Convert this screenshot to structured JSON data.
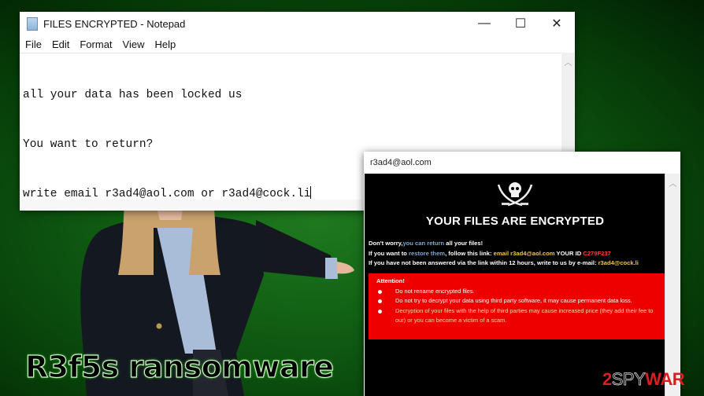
{
  "notepad": {
    "title": "FILES ENCRYPTED - Notepad",
    "controls": {
      "minimize": "—",
      "maximize": "☐",
      "close": "✕"
    },
    "menu": [
      "File",
      "Edit",
      "Format",
      "View",
      "Help"
    ],
    "lines": [
      "all your data has been locked us",
      "You want to return?",
      "write email r3ad4@aol.com or r3ad4@cock.li"
    ]
  },
  "ransom_window": {
    "title": "r3ad4@aol.com",
    "heading": "YOUR FILES ARE ENCRYPTED",
    "line1": {
      "a": "Don't worry,",
      "b": "you can return",
      "c": " all your files!"
    },
    "line2": {
      "a": "If you want to ",
      "b": "restore them",
      "c": ", follow this link: ",
      "d": "email r3ad4@aol.com",
      "e": " YOUR ID ",
      "f": "C279F237"
    },
    "line3": {
      "a": "If you have not been answered via the link within 12 hours, write to us by e-mail: ",
      "b": "r3ad4@cock.li"
    },
    "attention": {
      "title": "Attention!",
      "items": [
        "Do not rename encrypted files.",
        "Do not try to decrypt your data using third party software, it may cause permanent data loss.",
        "Decryption of your files with the help of third parties may cause increased price (they add their fee to our) or you can become a victim of a scam."
      ]
    },
    "colors": {
      "attention_bg": "#ee0000",
      "email": "#f2c644",
      "id": "#ff3b3b"
    }
  },
  "caption": "R3f5s ransomware",
  "logo": {
    "prefix": "2",
    "mid": "SPY",
    "suffix": "WAR"
  }
}
